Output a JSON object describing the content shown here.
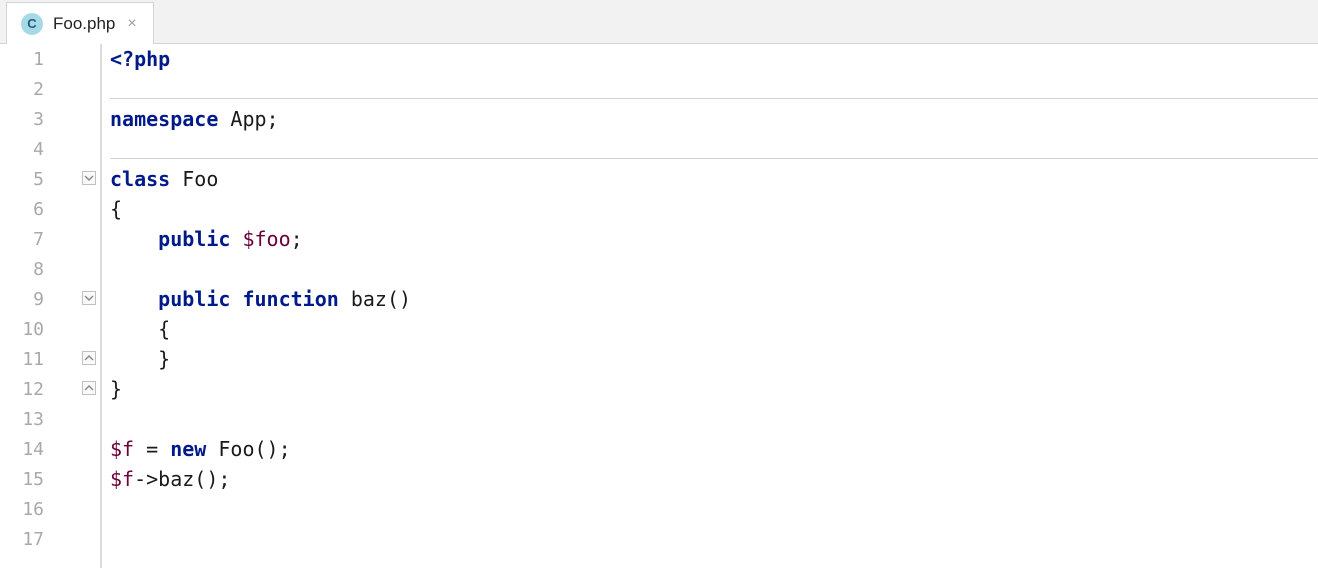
{
  "tab": {
    "icon_letter": "C",
    "filename": "Foo.php"
  },
  "gutter": {
    "lines": [
      "1",
      "2",
      "3",
      "4",
      "5",
      "6",
      "7",
      "8",
      "9",
      "10",
      "11",
      "12",
      "13",
      "14",
      "15",
      "16",
      "17"
    ]
  },
  "fold": {
    "markers": [
      {
        "line": 5,
        "dir": "down"
      },
      {
        "line": 9,
        "dir": "down"
      },
      {
        "line": 11,
        "dir": "up"
      },
      {
        "line": 12,
        "dir": "up"
      }
    ]
  },
  "code": {
    "l1": {
      "t1": "<?php"
    },
    "l3": {
      "t1": "namespace",
      "t2": " App;"
    },
    "l5": {
      "t1": "class",
      "t2": " Foo"
    },
    "l6": {
      "t1": "{"
    },
    "l7": {
      "pad": "    ",
      "t1": "public",
      "sp": " ",
      "t2": "$foo",
      "t3": ";"
    },
    "l9": {
      "pad": "    ",
      "t1": "public",
      "sp": " ",
      "t2": "function",
      "t3": " baz()"
    },
    "l10": {
      "pad": "    ",
      "t1": "{"
    },
    "l11": {
      "pad": "    ",
      "t1": "}"
    },
    "l12": {
      "t1": "}"
    },
    "l14": {
      "t1": "$f",
      "t2": " = ",
      "t3": "new",
      "t4": " Foo();"
    },
    "l15": {
      "t1": "$f",
      "t2": "->baz();"
    }
  }
}
